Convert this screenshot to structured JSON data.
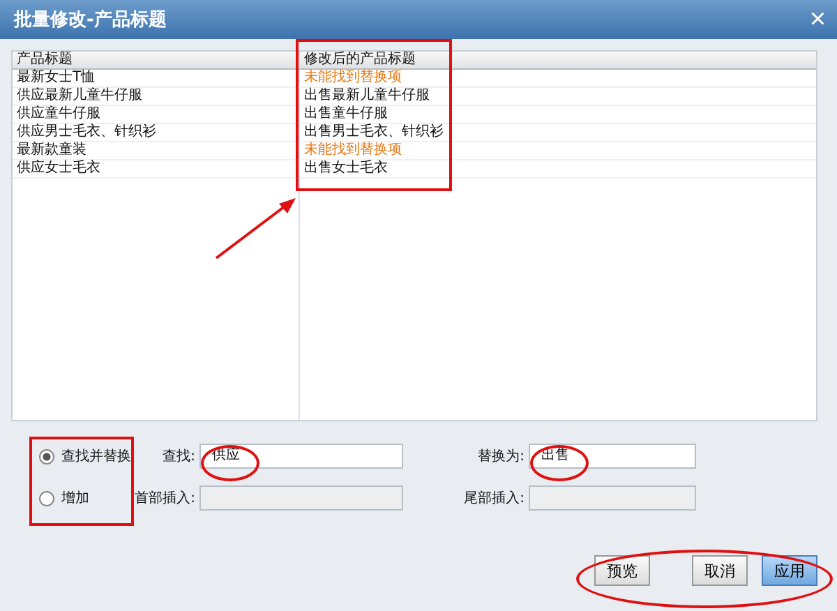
{
  "window": {
    "title": "批量修改-产品标题",
    "close": "×"
  },
  "table": {
    "columns": [
      "产品标题",
      "修改后的产品标题"
    ],
    "rows": [
      {
        "original": "最新女士T恤",
        "result": "未能找到替换项",
        "matched": false
      },
      {
        "original": "供应最新儿童牛仔服",
        "result": "出售最新儿童牛仔服",
        "matched": true
      },
      {
        "original": "供应童牛仔服",
        "result": "出售童牛仔服",
        "matched": true
      },
      {
        "original": "供应男士毛衣、针织衫",
        "result": "出售男士毛衣、针织衫",
        "matched": true
      },
      {
        "original": "最新款童装",
        "result": "未能找到替换项",
        "matched": false
      },
      {
        "original": "供应女士毛衣",
        "result": "出售女士毛衣",
        "matched": true
      }
    ]
  },
  "modes": [
    {
      "label": "查找并替换",
      "selected": true
    },
    {
      "label": "增加",
      "selected": false
    }
  ],
  "fields": [
    {
      "label": "查找:",
      "value": "供应",
      "disabled": false
    },
    {
      "label": "替换为:",
      "value": "出售",
      "disabled": false
    },
    {
      "label": "首部插入:",
      "disabled": true
    },
    {
      "label": "尾部插入:",
      "disabled": true
    }
  ],
  "buttons": [
    {
      "label": "预览",
      "primary": false
    },
    {
      "label": "取消",
      "primary": false
    },
    {
      "label": "应用",
      "primary": true
    }
  ]
}
